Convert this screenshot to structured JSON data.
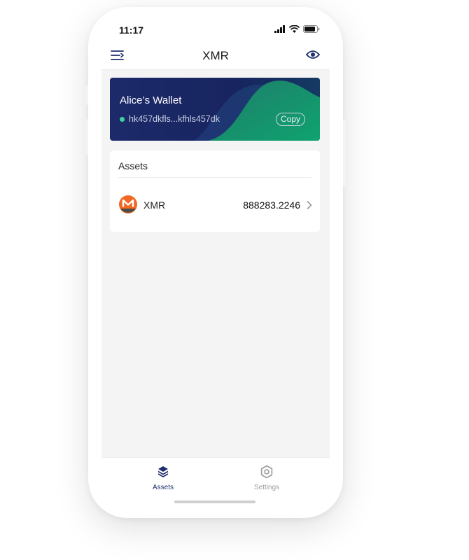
{
  "status_bar": {
    "time": "11:17",
    "icons": [
      "signal-icon",
      "wifi-icon",
      "battery-icon"
    ]
  },
  "navbar": {
    "title": "XMR",
    "left_icon": "menu-icon",
    "right_icon": "eye-icon"
  },
  "wallet": {
    "name": "Alice’s Wallet",
    "address": "hk457dkfls...kfhls457dk",
    "copy_label": "Copy",
    "status_color": "#3fd39a"
  },
  "assets": {
    "title": "Assets",
    "items": [
      {
        "symbol": "XMR",
        "amount": "888283.2246",
        "icon": "monero-icon"
      }
    ]
  },
  "tabbar": {
    "tabs": [
      {
        "label": "Assets",
        "icon": "layers-icon",
        "active": true
      },
      {
        "label": "Settings",
        "icon": "hexagon-settings-icon",
        "active": false
      }
    ]
  },
  "colors": {
    "brand_navy": "#1c2a6b",
    "brand_green": "#0e9a6a",
    "monero_orange": "#f26822",
    "background": "#f4f4f5"
  }
}
